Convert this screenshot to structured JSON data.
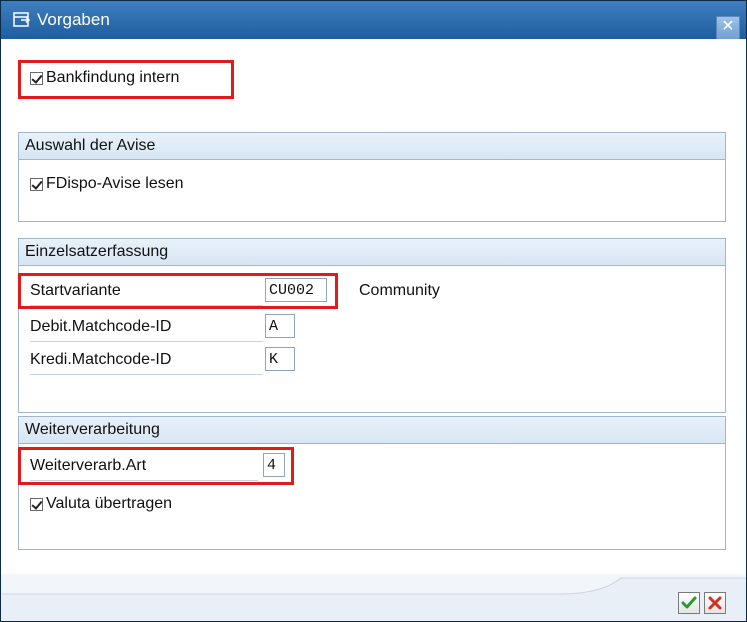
{
  "window": {
    "title": "Vorgaben",
    "title_icon": "dialog-icon",
    "close_glyph": "✕"
  },
  "bankfindung": {
    "label": "Bankfindung intern",
    "checked": true
  },
  "avise": {
    "header": "Auswahl der Avise",
    "fdispo_label": "FDispo-Avise lesen",
    "fdispo_checked": true
  },
  "einzelsatz": {
    "header": "Einzelsatzerfassung",
    "fields": [
      {
        "label": "Startvariante",
        "value": "CU002",
        "description": "Community"
      },
      {
        "label": "Debit.Matchcode-ID",
        "value": "A"
      },
      {
        "label": "Kredi.Matchcode-ID",
        "value": "K"
      }
    ]
  },
  "weiter": {
    "header": "Weiterverarbeitung",
    "art_label": "Weiterverarb.Art",
    "art_value": "4",
    "valuta_label": "Valuta übertragen",
    "valuta_checked": true
  },
  "buttons": {
    "confirm_icon": "green-check-icon",
    "cancel_icon": "red-x-icon"
  },
  "colors": {
    "titlebar": "#2b6aa8",
    "highlight": "#e01b1b",
    "group_border": "#9fb6cc"
  }
}
